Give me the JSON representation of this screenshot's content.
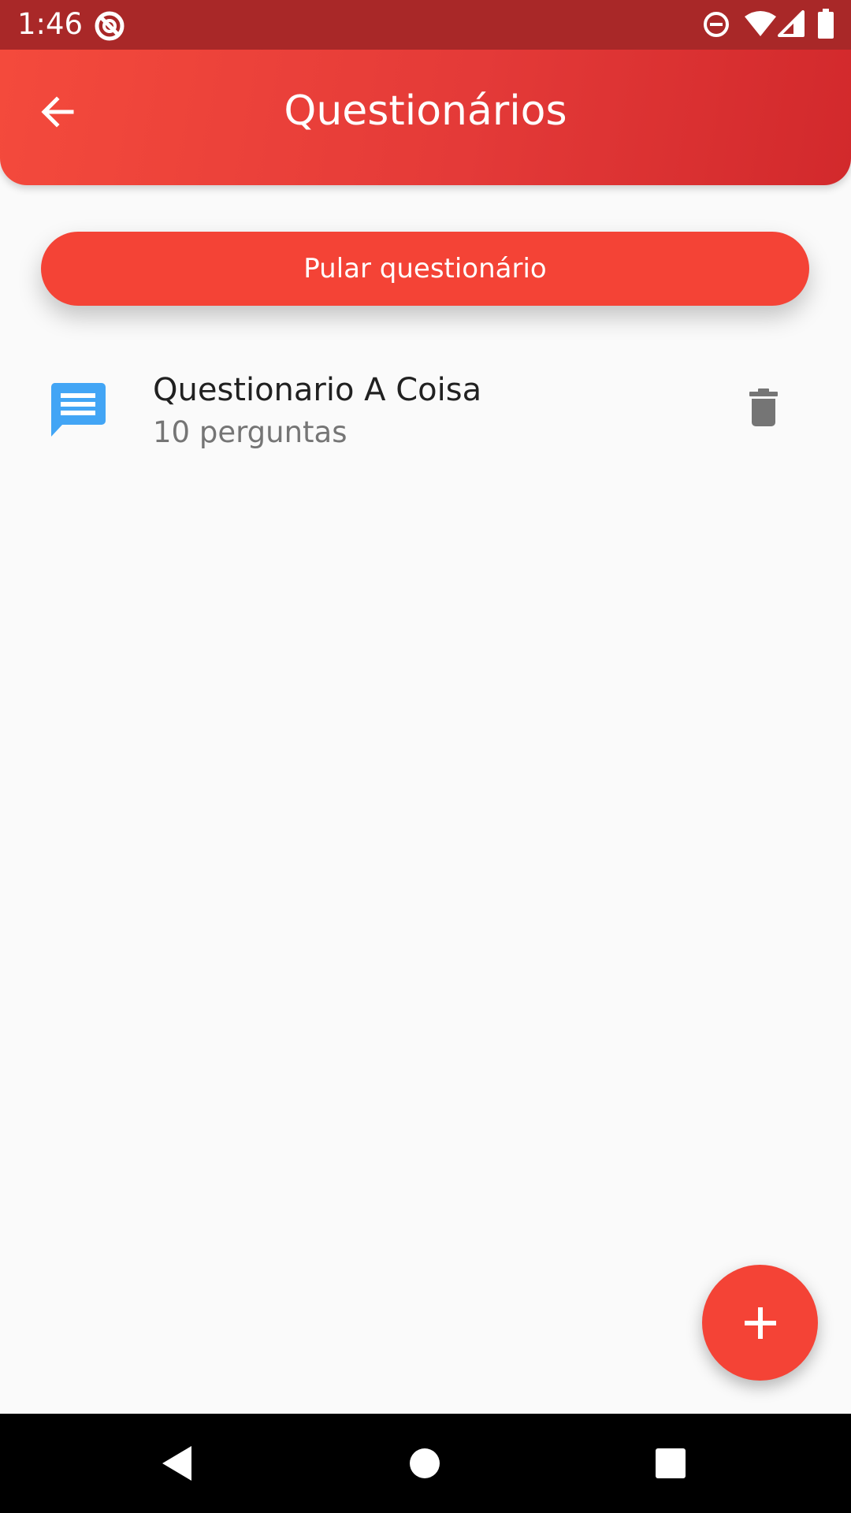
{
  "status_bar": {
    "time": "1:46",
    "icons": [
      "no-sync-icon",
      "do-not-disturb-icon",
      "wifi-icon",
      "signal-icon",
      "battery-icon"
    ]
  },
  "app_bar": {
    "title": "Questionários",
    "back_icon": "arrow-left-icon"
  },
  "skip_button": {
    "label": "Pular questionário"
  },
  "questionnaires": [
    {
      "title": "Questionario A Coisa",
      "subtitle": "10 perguntas",
      "icon": "chat-message-icon",
      "action_icon": "trash-icon"
    }
  ],
  "fab": {
    "icon": "plus-icon"
  },
  "nav_bar": {
    "buttons": [
      "back-triangle-icon",
      "home-circle-icon",
      "recents-square-icon"
    ]
  },
  "colors": {
    "primary": "#f44336",
    "app_bar_start": "#f44a3c",
    "app_bar_end": "#d2292c",
    "status_bar": "#a92828",
    "chat_icon": "#42a5f5",
    "trash_icon": "#757575",
    "background": "#fafafa"
  }
}
